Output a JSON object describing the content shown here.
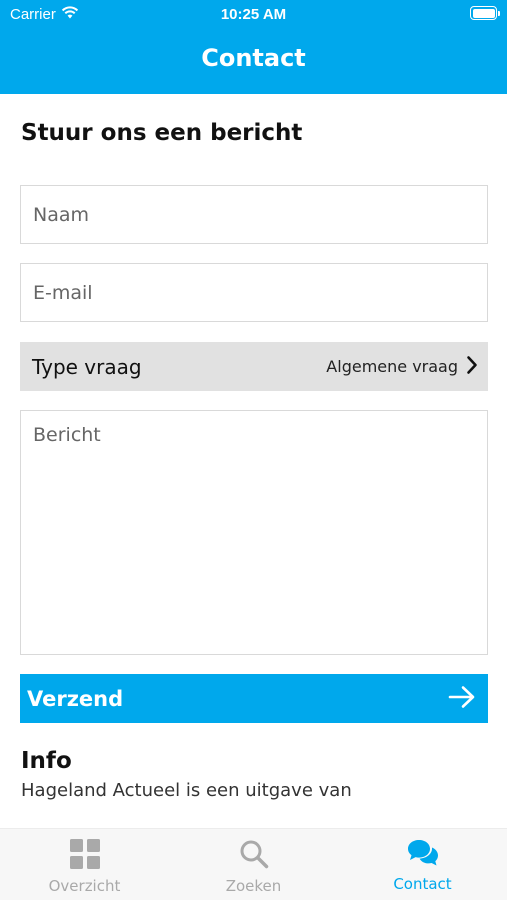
{
  "status_bar": {
    "carrier": "Carrier",
    "time": "10:25 AM",
    "battery_level": 1.0
  },
  "header": {
    "title": "Contact"
  },
  "form": {
    "title": "Stuur ons een bericht",
    "name_placeholder": "Naam",
    "email_placeholder": "E-mail",
    "type_label": "Type vraag",
    "type_value": "Algemene vraag",
    "message_placeholder": "Bericht",
    "submit_label": "Verzend"
  },
  "info": {
    "title": "Info",
    "text": "Hageland Actueel is een uitgave van"
  },
  "tabs": [
    {
      "label": "Overzicht",
      "icon": "grid-icon",
      "active": false
    },
    {
      "label": "Zoeken",
      "icon": "search-icon",
      "active": false
    },
    {
      "label": "Contact",
      "icon": "chat-bubbles-icon",
      "active": true
    }
  ],
  "colors": {
    "accent": "#00a8ec",
    "inactive": "#a9a9a9",
    "select_background": "#e1e1e1"
  }
}
